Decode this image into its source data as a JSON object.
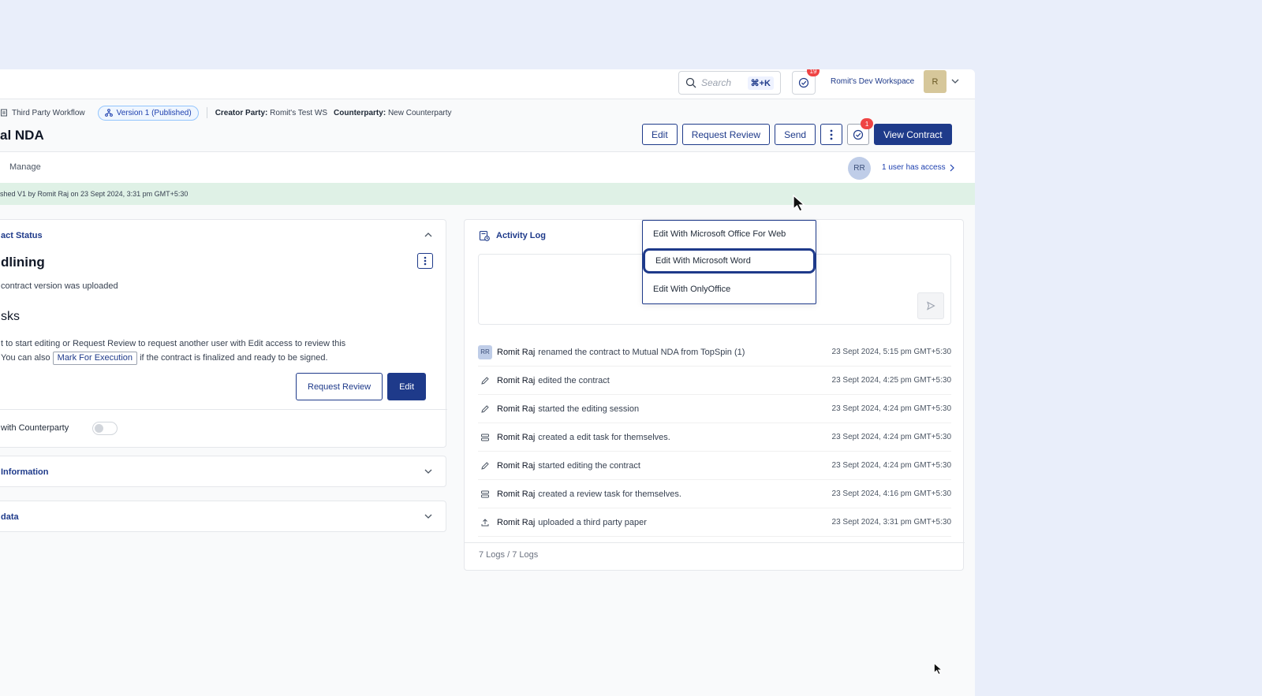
{
  "topbar": {
    "search_placeholder": "Search",
    "search_shortcut": "⌘+K",
    "tasks_badge": "19",
    "workspace_name": "Romit's Dev Workspace",
    "workspace_avatar": "R"
  },
  "meta": {
    "workflow": "Third Party Workflow",
    "version": "Version 1 (Published)",
    "creator_label": "Creator Party:",
    "creator_value": "Romit's Test WS",
    "counterparty_label": "Counterparty:",
    "counterparty_value": "New Counterparty"
  },
  "document": {
    "title": "al NDA"
  },
  "actions": {
    "edit": "Edit",
    "request_review": "Request Review",
    "send": "Send",
    "approvals_badge": "1",
    "view_contract": "View Contract"
  },
  "edit_menu": {
    "items": [
      "Edit With Microsoft Office For Web",
      "Edit With Microsoft Word",
      "Edit With OnlyOffice"
    ]
  },
  "tabs": {
    "manage": "Manage",
    "access_avatar": "RR",
    "access_text": "1 user has access"
  },
  "banner": {
    "text": "shed V1 by Romit Raj on 23 Sept 2024, 3:31 pm GMT+5:30"
  },
  "status_card": {
    "heading": "act Status",
    "stage": "dlining",
    "stage_desc": "contract version was uploaded",
    "tasks_title": "sks",
    "task_line1": "t to start editing or Request Review to request another user with Edit access to review this",
    "task_line2_pre": " You can also",
    "mark_for_execution": "Mark For Execution",
    "task_line2_post": "if the contract is finalized and ready to be signed.",
    "request_review": "Request Review",
    "edit": "Edit",
    "share_label": "with Counterparty"
  },
  "accordions": {
    "information": "Information",
    "data": "data"
  },
  "activity_log": {
    "title": "Activity Log",
    "entries": [
      {
        "user": "Romit Raj",
        "action": "renamed the contract to Mutual NDA from TopSpin (1)",
        "time": "23 Sept 2024, 5:15 pm GMT+5:30",
        "icon": "RR"
      },
      {
        "user": "Romit Raj",
        "action": "edited the contract",
        "time": "23 Sept 2024, 4:25 pm GMT+5:30",
        "icon": "pencil-icon"
      },
      {
        "user": "Romit Raj",
        "action": "started the editing session",
        "time": "23 Sept 2024, 4:24 pm GMT+5:30",
        "icon": "pencil-icon"
      },
      {
        "user": "Romit Raj",
        "action": "created a edit task for themselves.",
        "time": "23 Sept 2024, 4:24 pm GMT+5:30",
        "icon": "task-icon"
      },
      {
        "user": "Romit Raj",
        "action": "started editing the contract",
        "time": "23 Sept 2024, 4:24 pm GMT+5:30",
        "icon": "pencil-icon"
      },
      {
        "user": "Romit Raj",
        "action": "created a review task for themselves.",
        "time": "23 Sept 2024, 4:16 pm GMT+5:30",
        "icon": "task-icon"
      },
      {
        "user": "Romit Raj",
        "action": "uploaded a third party paper",
        "time": "23 Sept 2024, 3:31 pm GMT+5:30",
        "icon": "upload-icon"
      }
    ],
    "count": "7 Logs / 7 Logs"
  },
  "colors": {
    "primary": "#1e3a8a",
    "banner": "#dff1e6",
    "badge": "#ef4444"
  }
}
